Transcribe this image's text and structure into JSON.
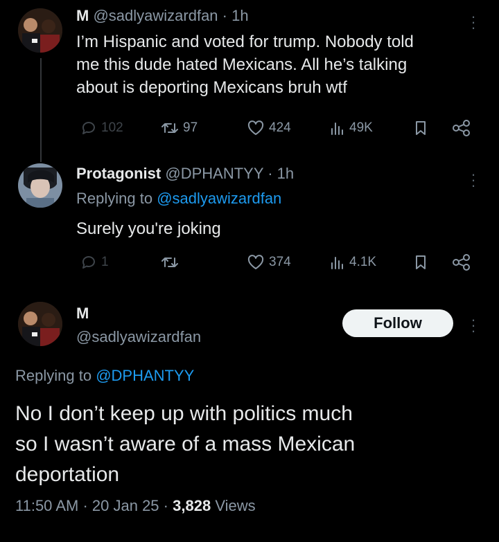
{
  "tweet1": {
    "name": "M",
    "handle": "@sadlyawizardfan",
    "time": "· 1h",
    "text_lines": [
      "I’m Hispanic and voted for trump. Nobody told",
      "me this dude hated Mexicans. All he’s talking",
      "about is deporting Mexicans bruh wtf"
    ],
    "replies": "102",
    "retweets": "97",
    "likes": "424",
    "views": "49K"
  },
  "tweet2": {
    "name": "Protagonist",
    "handle": "@DPHANTYY",
    "time": "· 1h",
    "replying_prefix": "Replying to",
    "replying_handle": "@sadlyawizardfan",
    "text": "Surely you're joking",
    "replies": "1",
    "retweets": "",
    "likes": "374",
    "views": "4.1K"
  },
  "tweet3": {
    "name": "M",
    "handle": "@sadlyawizardfan",
    "follow_label": "Follow",
    "replying_prefix": "Replying to",
    "replying_handle": "@DPHANTYY",
    "text_lines": [
      "No I don’t keep up with politics much",
      "so I wasn’t aware of a mass Mexican",
      "deportation"
    ],
    "time": "11:50 AM",
    "date": "20 Jan 25",
    "views_count": "3,828",
    "views_label": "Views"
  },
  "colors": {
    "background": "#000000",
    "text": "#e7e9ea",
    "muted": "#8b98a5",
    "link": "#1d9bf0",
    "button_bg": "#eff3f4"
  }
}
